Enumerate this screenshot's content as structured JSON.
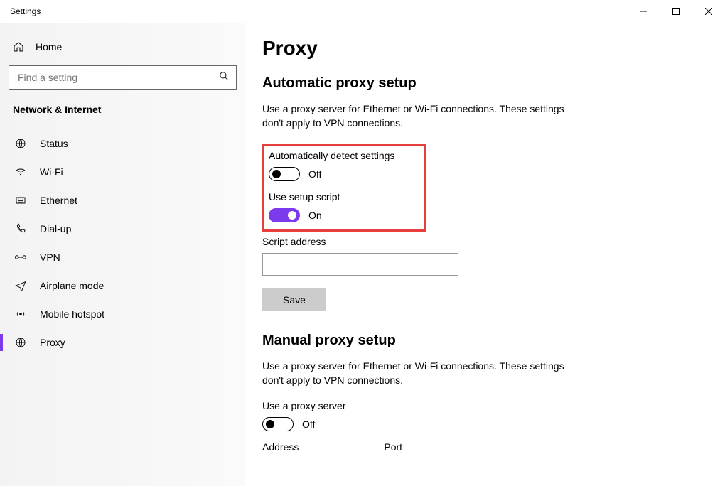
{
  "window": {
    "title": "Settings"
  },
  "sidebar": {
    "home": "Home",
    "search_placeholder": "Find a setting",
    "section": "Network & Internet",
    "items": [
      {
        "label": "Status"
      },
      {
        "label": "Wi-Fi"
      },
      {
        "label": "Ethernet"
      },
      {
        "label": "Dial-up"
      },
      {
        "label": "VPN"
      },
      {
        "label": "Airplane mode"
      },
      {
        "label": "Mobile hotspot"
      },
      {
        "label": "Proxy"
      }
    ]
  },
  "main": {
    "title": "Proxy",
    "auto": {
      "heading": "Automatic proxy setup",
      "desc": "Use a proxy server for Ethernet or Wi-Fi connections. These settings don't apply to VPN connections.",
      "detect_label": "Automatically detect settings",
      "detect_state": "Off",
      "script_label": "Use setup script",
      "script_state": "On",
      "address_label": "Script address",
      "address_value": "",
      "save": "Save"
    },
    "manual": {
      "heading": "Manual proxy setup",
      "desc": "Use a proxy server for Ethernet or Wi-Fi connections. These settings don't apply to VPN connections.",
      "use_label": "Use a proxy server",
      "use_state": "Off",
      "addr_label": "Address",
      "port_label": "Port"
    }
  }
}
